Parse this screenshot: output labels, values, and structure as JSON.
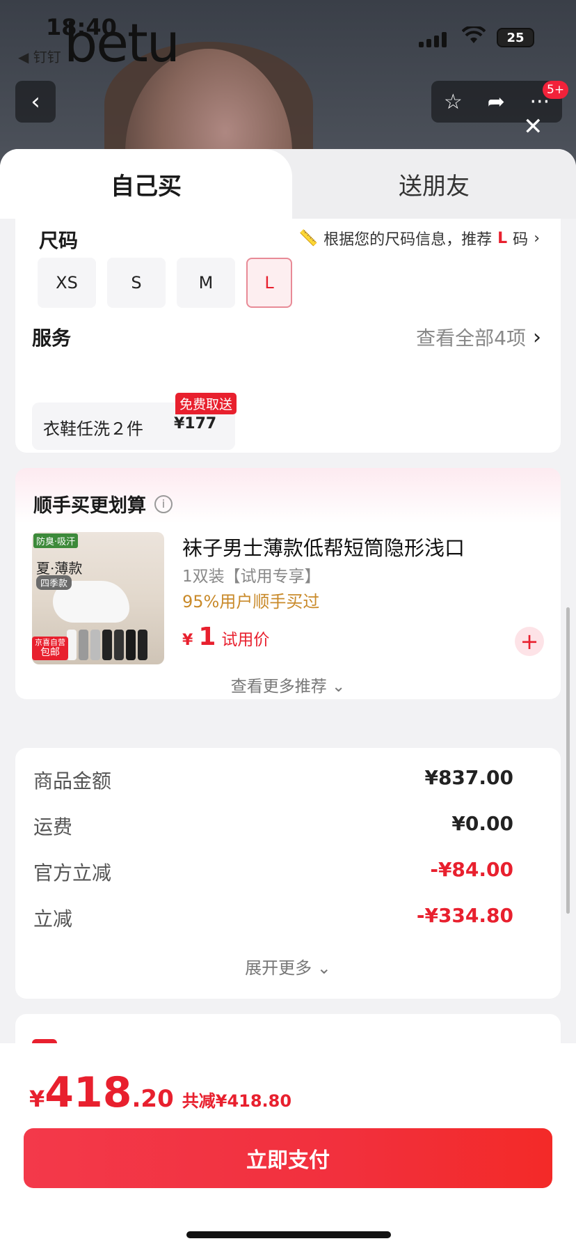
{
  "status_bar": {
    "time": "18:40",
    "back_app": "◀ 钉钉",
    "battery": "25",
    "watermark": "betu"
  },
  "nav": {
    "back_icon": "chevron-left-icon",
    "badge": "5+",
    "icons": [
      "star-icon",
      "share-icon",
      "more-icon",
      "close-icon"
    ]
  },
  "tabs": [
    {
      "label": "自己买",
      "active": true
    },
    {
      "label": "送朋友",
      "active": false
    }
  ],
  "size": {
    "title": "尺码",
    "recommend_prefix": "根据您的尺码信息，推荐",
    "recommend_size": "L",
    "recommend_suffix": "码",
    "options": [
      "XS",
      "S",
      "M",
      "L"
    ],
    "selected": "L"
  },
  "service": {
    "title": "服务",
    "view_all": "查看全部4项",
    "item_name": "衣鞋任洗２件",
    "item_price": "¥177",
    "item_tag": "免费取送"
  },
  "recommend": {
    "title": "顺手买更划算",
    "product": {
      "name": "袜子男士薄款低帮短筒隐形浅口",
      "subtitle": "1双装【试用专享】",
      "stat": "95%用户顺手买过",
      "price_symbol": "¥",
      "price": "1",
      "price_label": "试用价",
      "image_tag1": "防臭·吸汗",
      "image_text1": "夏·薄款",
      "image_text2": "四季款",
      "image_tag2_line1": "京喜自营",
      "image_tag2_line2": "包邮"
    },
    "more": "查看更多推荐"
  },
  "summary": {
    "rows": [
      {
        "label": "商品金额",
        "value": "¥837.00",
        "red": false
      },
      {
        "label": "运费",
        "value": "¥0.00",
        "red": false
      },
      {
        "label": "官方立减",
        "value": "-¥84.00",
        "red": true
      },
      {
        "label": "立减",
        "value": "-¥334.80",
        "red": true
      }
    ],
    "expand": "展开更多"
  },
  "footer": {
    "currency": "¥",
    "total_int": "418",
    "total_dec": ".20",
    "saved": "共减¥418.80",
    "pay_label": "立即支付"
  },
  "colors": {
    "accent": "#e8202e",
    "pay_gradient_start": "#f3394a",
    "pay_gradient_end": "#f32a28",
    "stat_orange": "#c98a2a"
  }
}
